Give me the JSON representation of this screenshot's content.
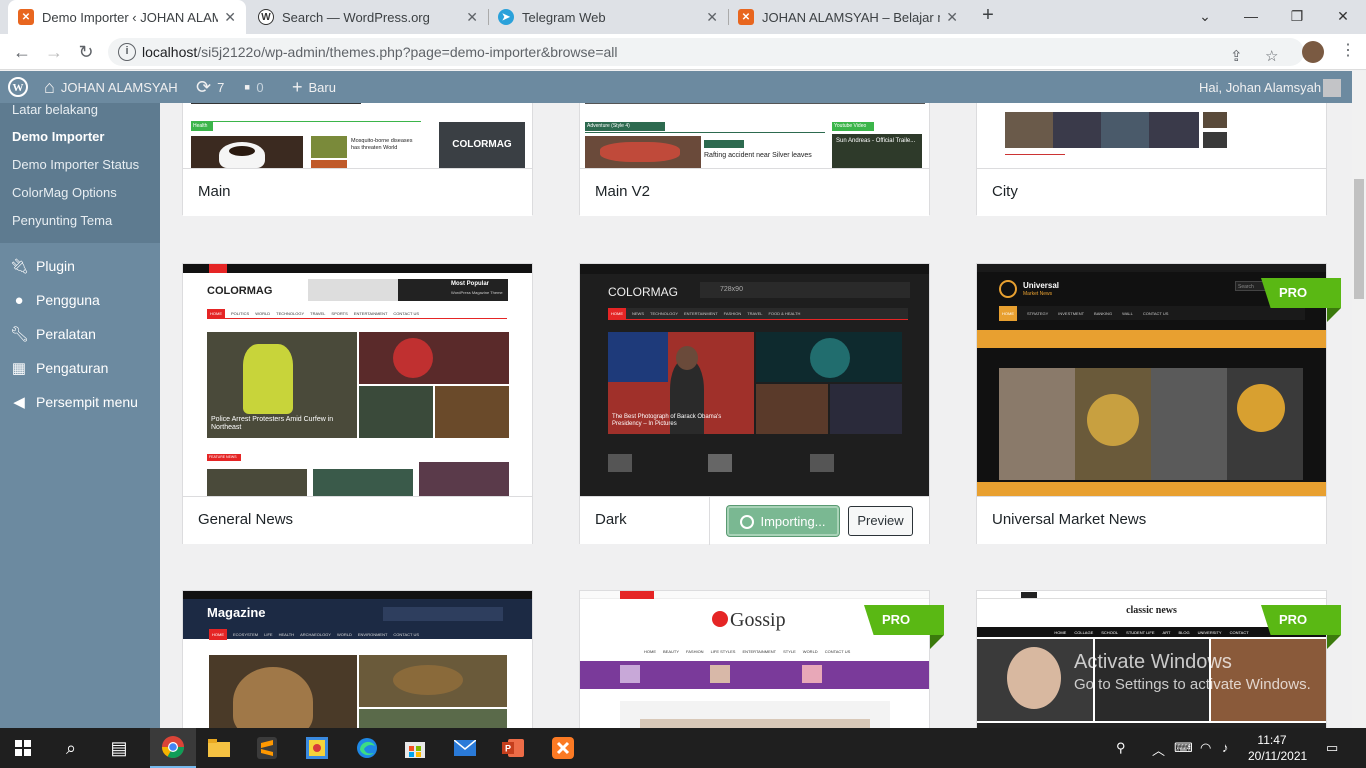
{
  "browser": {
    "tabs": [
      {
        "title": "Demo Importer ‹ JOHAN ALAMSYAH",
        "fav": "xampp-icon",
        "color": "#e8661f"
      },
      {
        "title": "Search — WordPress.org",
        "fav": "wordpress-icon",
        "color": "#333"
      },
      {
        "title": "Telegram Web",
        "fav": "telegram-icon",
        "color": "#2aa1da"
      },
      {
        "title": "JOHAN ALAMSYAH – Belajar mar",
        "fav": "xampp-icon",
        "color": "#e8661f"
      }
    ],
    "url_host": "localhost",
    "url_path": "/si5j2122o/wp-admin/themes.php?page=demo-importer&browse=all"
  },
  "adminbar": {
    "site_name": "JOHAN ALAMSYAH",
    "updates_count": "7",
    "comments_count": "0",
    "new_label": "Baru",
    "greeting": "Hai, Johan Alamsyah"
  },
  "sidebar": {
    "submenu": [
      "Latar belakang",
      "Demo Importer",
      "Demo Importer Status",
      "ColorMag Options",
      "Penyunting Tema"
    ],
    "menu": [
      {
        "label": "Plugin",
        "icon": "plugin-icon"
      },
      {
        "label": "Pengguna",
        "icon": "users-icon"
      },
      {
        "label": "Peralatan",
        "icon": "tools-icon"
      },
      {
        "label": "Pengaturan",
        "icon": "settings-icon"
      },
      {
        "label": "Persempit menu",
        "icon": "collapse-icon"
      }
    ]
  },
  "demos": {
    "row1": [
      "Main",
      "Main V2",
      "City"
    ],
    "row2": [
      "General News",
      "Dark",
      "Universal Market News"
    ],
    "pro_label": "PRO",
    "importing_label": "Importing...",
    "preview_label": "Preview"
  },
  "thumbs": {
    "main_health": "Health",
    "main_headline": "Mosquito-borne diseases has threaten World",
    "main_logo": "COLORMAG",
    "mainv2_section": "Adventure (Style 4)",
    "mainv2_headline": "Rafting accident near Silver leaves",
    "mainv2_video": "Youtube Video",
    "mainv2_video_title": "Sun Andreas - Official Traile...",
    "gn_logo": "COLORMAG",
    "gn_nav": [
      "HOME",
      "POLITICS",
      "WORLD",
      "TECHNOLOGY",
      "TRAVEL",
      "SPORTS",
      "ENTERTAINMENT",
      "CONTACT US"
    ],
    "gn_headline": "Police Arrest Protesters Amid Curfew in Northeast",
    "gn_popular": "Most Popular",
    "gn_popular_sub": "WordPress Magazine Theme",
    "gn_feature": "FEATURE NEWS",
    "dark_logo": "COLORMAG",
    "dark_ad": "728x90",
    "dark_headline": "The Best Photograph of Barack Obama's Presidency – In Pictures",
    "dark_nav": [
      "HOME",
      "NEWS",
      "TECHNOLOGY",
      "ENTERTAINMENT",
      "FASHION",
      "TRAVEL",
      "FOOD & HEALTH"
    ],
    "um_logo": "Universal",
    "um_logo_sub": "Market News",
    "um_search": "Search",
    "um_nav": [
      "HOME",
      "STRATEGY",
      "INVESTMENT",
      "BANKING",
      "WALL",
      "CONTACT US"
    ],
    "mag_logo": "Magazine",
    "mag_nav": [
      "HOME",
      "ECOSYSTEM",
      "LIFE",
      "HEALTH",
      "ARCHAEOLOGY",
      "WORLD",
      "ENVIRONMENT",
      "CONTACT US"
    ],
    "gossip_logo": "Gossip",
    "gossip_nav": [
      "HOME",
      "BEAUTY",
      "FASHION",
      "LIFE STYLES",
      "ENTERTAINMENT",
      "STYLE",
      "WORLD",
      "CONTACT US"
    ],
    "classic_logo": "classic news",
    "classic_nav": [
      "HOME",
      "COLLAGE",
      "SCHOOL",
      "STUDENT LIFE",
      "ART",
      "BLOG",
      "UNIVERSITY",
      "CONTACT"
    ]
  },
  "watermark": {
    "title": "Activate Windows",
    "subtitle": "Go to Settings to activate Windows."
  },
  "taskbar": {
    "time": "11:47",
    "date": "20/11/2021"
  },
  "colors": {
    "admin_bg": "#6c8aa0",
    "pro_green": "#5ab814",
    "colormag_red": "#e52525"
  }
}
